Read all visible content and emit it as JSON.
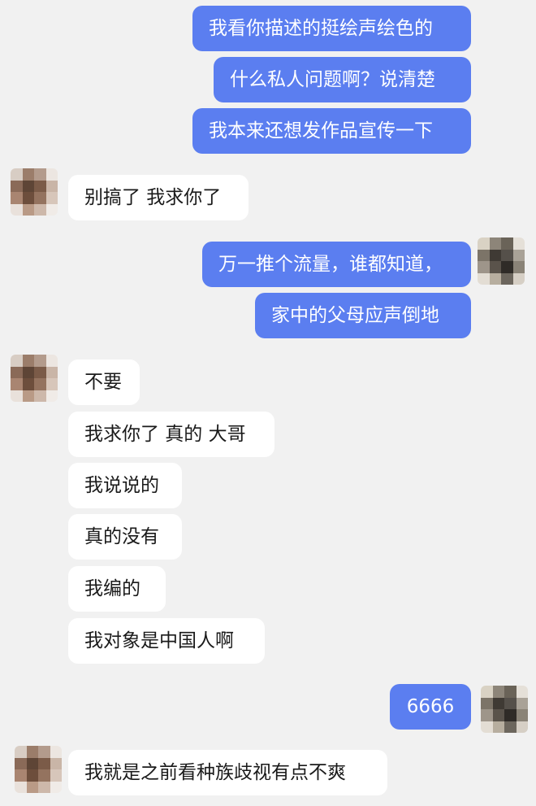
{
  "messages": [
    {
      "text": "我看你描述的挺绘声绘色的"
    },
    {
      "text": "什么私人问题啊？说清楚"
    },
    {
      "text": "我本来还想发作品宣传一下"
    },
    {
      "text": "别搞了 我求你了"
    },
    {
      "text": "万一推个流量，谁都知道，"
    },
    {
      "text": "家中的父母应声倒地"
    },
    {
      "text": "不要"
    },
    {
      "text": "我求你了 真的 大哥"
    },
    {
      "text": "我说说的"
    },
    {
      "text": "真的没有"
    },
    {
      "text": "我编的"
    },
    {
      "text": "我对象是中国人啊"
    },
    {
      "text": "6666"
    },
    {
      "text": "我就是之前看种族歧视有点不爽"
    }
  ],
  "colors": {
    "background": "#f1f1f1",
    "outgoing_bubble": "#5b7ef0",
    "incoming_bubble": "#ffffff"
  },
  "icons": {
    "avatar": "pixelated-avatar-icon"
  }
}
